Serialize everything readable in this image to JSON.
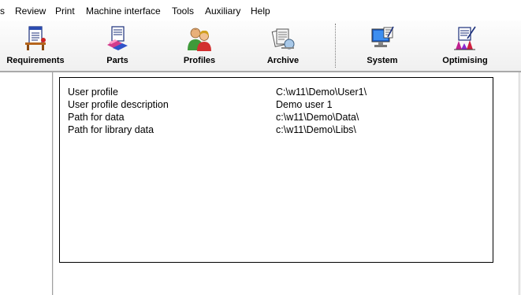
{
  "menubar": {
    "items": [
      "s",
      "Review",
      "Print",
      "Machine interface",
      "Tools",
      "Auxiliary",
      "Help"
    ]
  },
  "toolbar": {
    "buttons": [
      {
        "label": "Requirements",
        "icon": "requirements-icon"
      },
      {
        "label": "Parts",
        "icon": "parts-icon"
      },
      {
        "label": "Profiles",
        "icon": "profiles-icon"
      },
      {
        "label": "Archive",
        "icon": "archive-icon"
      },
      {
        "label": "System",
        "icon": "system-icon"
      },
      {
        "label": "Optimising",
        "icon": "optimising-icon"
      }
    ]
  },
  "info": {
    "rows": [
      {
        "label": "User profile",
        "value": "C:\\w11\\Demo\\User1\\"
      },
      {
        "label": "User profile description",
        "value": "Demo user 1"
      },
      {
        "label": "Path for data",
        "value": "c:\\w11\\Demo\\Data\\"
      },
      {
        "label": "Path for library data",
        "value": "c:\\w11\\Demo\\Libs\\"
      }
    ]
  }
}
